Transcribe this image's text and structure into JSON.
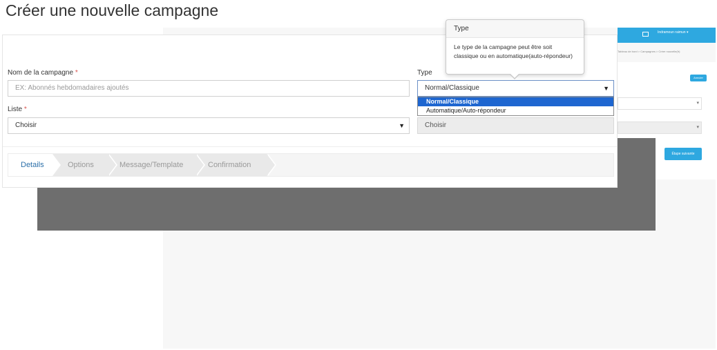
{
  "page": {
    "title": "Créer une nouvelle campagne"
  },
  "form": {
    "campaign_name": {
      "label": "Nom de la campagne",
      "required_mark": "*",
      "placeholder": "EX: Abonnés hebdomadaires ajoutés",
      "value": ""
    },
    "type": {
      "label": "Type",
      "selected": "Normal/Classique",
      "caret": "▼",
      "options": [
        "Normal/Classique",
        "Automatique/Auto-répondeur"
      ]
    },
    "list": {
      "label": "Liste",
      "required_mark": "*",
      "selected": "Choisir",
      "caret": "▼"
    },
    "disabled_select": {
      "selected": "Choisir"
    }
  },
  "wizard": {
    "steps": [
      {
        "label": "Details",
        "active": true
      },
      {
        "label": "Options",
        "active": false
      },
      {
        "label": "Message/Template",
        "active": false
      },
      {
        "label": "Confirmation",
        "active": false
      }
    ]
  },
  "popover": {
    "title": "Type",
    "body": "Le type de la campagne peut être soit classique ou en automatique(auto-répondeur)"
  },
  "background_app": {
    "user_label": "Indramoun raimun ▾",
    "breadcrumb": "Tableau de bord  >  Campagnes  >  Créer nouvelle(fr)",
    "small_button": "Annuler",
    "next_button": "Étape suivante"
  },
  "colors": {
    "accent": "#2ea8e0",
    "dropdown_highlight": "#1e66d0",
    "required": "#d9534f",
    "active_step": "#2b6fa8"
  }
}
